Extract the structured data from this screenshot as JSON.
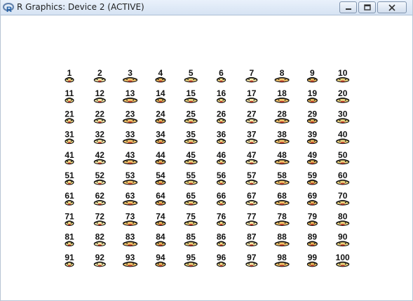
{
  "window": {
    "title": "R Graphics: Device 2 (ACTIVE)",
    "controls": [
      "minimize-icon",
      "maximize-icon",
      "close-icon"
    ]
  },
  "plot": {
    "rows": 10,
    "cols": 10,
    "labels": [
      "1",
      "2",
      "3",
      "4",
      "5",
      "6",
      "7",
      "8",
      "9",
      "10",
      "11",
      "12",
      "13",
      "14",
      "15",
      "16",
      "17",
      "18",
      "19",
      "20",
      "21",
      "22",
      "23",
      "24",
      "25",
      "26",
      "27",
      "28",
      "29",
      "30",
      "31",
      "32",
      "33",
      "34",
      "35",
      "36",
      "37",
      "38",
      "39",
      "40",
      "41",
      "42",
      "43",
      "44",
      "45",
      "46",
      "47",
      "48",
      "49",
      "50",
      "51",
      "52",
      "53",
      "54",
      "55",
      "56",
      "57",
      "58",
      "59",
      "60",
      "61",
      "62",
      "63",
      "64",
      "65",
      "66",
      "67",
      "68",
      "69",
      "70",
      "71",
      "72",
      "73",
      "74",
      "75",
      "76",
      "77",
      "78",
      "79",
      "80",
      "81",
      "82",
      "83",
      "84",
      "85",
      "86",
      "87",
      "88",
      "89",
      "90",
      "91",
      "92",
      "93",
      "94",
      "95",
      "96",
      "97",
      "98",
      "99",
      "100"
    ],
    "glyph": "face-icon",
    "colors": {
      "skin": "#f5e08a",
      "mouth": "#c0392b",
      "hair": "#111111",
      "outline": "#111111"
    }
  }
}
